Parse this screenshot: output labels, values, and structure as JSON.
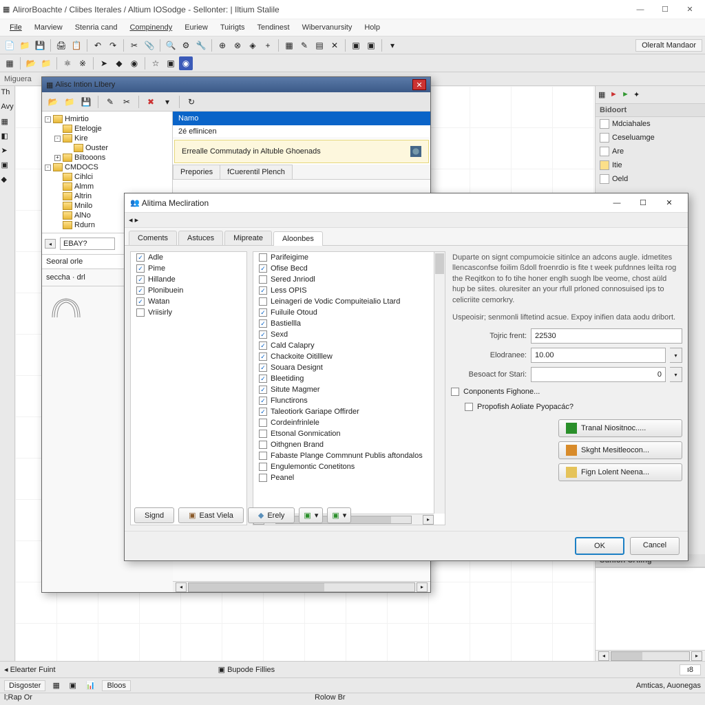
{
  "main_window": {
    "title": "AlirorBoachte / Clibes Iterales / Altium IOSodge - Sellonter: | Iltium Stalile",
    "menu": [
      "File",
      "Marview",
      "Stenria cand",
      "Compinendy",
      "Euriew",
      "Tuirigts",
      "Tendinest",
      "Wibervanursity",
      "Holp"
    ],
    "right_label": "Oleralt Mandaor",
    "left_panel": "Miguera",
    "avy_label": "Avy",
    "bottom_tabs": {
      "left": "Elearter Fuint",
      "mid": "Bupode Fillies"
    },
    "status": {
      "dispoder": "Disgoster",
      "bloos": "Bloos",
      "rpao": "l;Rap Or",
      "rolow": "Rolow Br",
      "right": "Amticas, Auonegas"
    }
  },
  "right_panel": {
    "header": "Bidoort",
    "items": [
      "Mdciahales",
      "Ceseluamge",
      "Are",
      "Itie",
      "Oeld"
    ],
    "bottom_header": "Sunion CAling"
  },
  "library": {
    "title": "Alisc Intion LIbery",
    "tree": [
      {
        "d": 0,
        "exp": "-",
        "label": "Hmirtio"
      },
      {
        "d": 1,
        "exp": "",
        "label": "Etelogje"
      },
      {
        "d": 1,
        "exp": "-",
        "label": "Kire"
      },
      {
        "d": 2,
        "exp": "",
        "label": "Ouster"
      },
      {
        "d": 1,
        "exp": "+",
        "label": "Biltooons"
      },
      {
        "d": 0,
        "exp": "-",
        "label": "CMDOCS"
      },
      {
        "d": 1,
        "exp": "",
        "label": "Cihlci"
      },
      {
        "d": 1,
        "exp": "",
        "label": "Almm"
      },
      {
        "d": 1,
        "exp": "",
        "label": "Altrin"
      },
      {
        "d": 1,
        "exp": "",
        "label": "Mnilo"
      },
      {
        "d": 1,
        "exp": "",
        "label": "AlNo"
      },
      {
        "d": 1,
        "exp": "",
        "label": "Rdurn"
      }
    ],
    "tree_input": "EBAY?",
    "tree_footer": "Seoral orle",
    "seccha": "seccha · drl",
    "name_header": "Namo",
    "name_row": "2é eflinicen",
    "banner": "Errealle Commutady in Altuble Ghoenads",
    "tabs": [
      "Prepories",
      "fCuerentil Plench"
    ]
  },
  "pref": {
    "title": "Alitima Mecliration",
    "tabs": [
      "Coments",
      "Astuces",
      "Mipreate",
      "Aloonbes"
    ],
    "active_tab": 3,
    "left_items": [
      {
        "c": true,
        "t": "Adle"
      },
      {
        "c": true,
        "t": "Pime"
      },
      {
        "c": true,
        "t": "Hillande"
      },
      {
        "c": true,
        "t": "Plonibuein"
      },
      {
        "c": true,
        "t": "Watan"
      },
      {
        "c": false,
        "t": "Vriisirly"
      }
    ],
    "mid_items": [
      {
        "c": false,
        "t": "Parifeigime"
      },
      {
        "c": true,
        "t": "Ofise Becd"
      },
      {
        "c": false,
        "t": "Sered Jnriodl"
      },
      {
        "c": true,
        "t": "Less OPIS"
      },
      {
        "c": false,
        "t": "Leinageri de Vodic Compuiteialio Ltard"
      },
      {
        "c": true,
        "t": "Fuiluile Otoud"
      },
      {
        "c": true,
        "t": "Bastiellla"
      },
      {
        "c": true,
        "t": "Sexd"
      },
      {
        "c": true,
        "t": "Cald Calapry"
      },
      {
        "c": true,
        "t": "Chackoite Oitilllew"
      },
      {
        "c": true,
        "t": "Souara Designt"
      },
      {
        "c": true,
        "t": "Bleetiding"
      },
      {
        "c": true,
        "t": "Situte Magmer"
      },
      {
        "c": true,
        "t": "Flunctirons"
      },
      {
        "c": true,
        "t": "Taleotiork Gariape Offirder"
      },
      {
        "c": false,
        "t": "Cordeinfrinlele"
      },
      {
        "c": false,
        "t": "Etsonal Gonmication"
      },
      {
        "c": false,
        "t": "Oithgnen Brand"
      },
      {
        "c": false,
        "t": "Fabaste Plange Commnunt Publis aftondalos"
      },
      {
        "c": false,
        "t": "Engulemontic Conetitons"
      },
      {
        "c": false,
        "t": "Peanel"
      }
    ],
    "desc1": "Duparte on signt compumoicie sitinlce an adcons augle. idmetites llencasconfse foilim ßdoll froenrdio is fite t week pufdnnes leilta rog the Reqitkon to fo tihe honer englh suogh lbe veome, chost aüld hup be siites. oluresiter an your rfull prloned connosuised ips to celicriite cemorkry.",
    "desc2": "Uspeoisir; senmonli liftetind acsue. Expoy inifien data aodu dribort.",
    "fields": {
      "tojric_label": "Tojric frent:",
      "tojric_val": "22530",
      "elodrane_label": "Elodranee:",
      "elodrane_val": "10.00",
      "besoact_label": "Besoact for Stari:",
      "besoact_val": "0"
    },
    "chk_components": "Conponents Fighone...",
    "chk_propofish": "Propofish Aoliate Pyopacác?",
    "actions": [
      "Tranal Niositnoc.....",
      "Skght Mesitleocon...",
      "Fign Lolent Neena..."
    ],
    "ok": "OK",
    "cancel": "Cancel",
    "footer": [
      "Signd",
      "East Viela",
      "Erely"
    ]
  }
}
